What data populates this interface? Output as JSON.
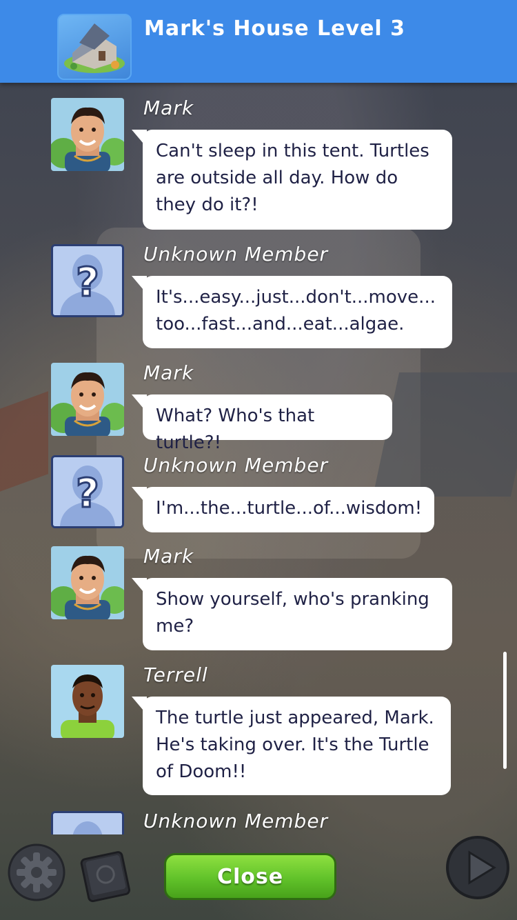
{
  "header": {
    "title": "Mark's House Level 3",
    "thumbnail_icon": "house-thumbnail-icon",
    "color": "#3d8ae8"
  },
  "messages": [
    {
      "sender": "Mark",
      "avatar": "mark",
      "text": "Can't sleep in this tent. Turtles are outside all day. How do they do it?!"
    },
    {
      "sender": "Unknown Member",
      "avatar": "unknown",
      "text": "It's...easy...just...don't...move... too...fast...and...eat...algae."
    },
    {
      "sender": "Mark",
      "avatar": "mark",
      "text": "What? Who's that turtle?!"
    },
    {
      "sender": "Unknown Member",
      "avatar": "unknown",
      "text": "I'm...the...turtle...of...wisdom!"
    },
    {
      "sender": "Mark",
      "avatar": "mark",
      "text": "Show yourself, who's pranking me?"
    },
    {
      "sender": "Terrell",
      "avatar": "terrell",
      "text": "The turtle just appeared, Mark. He's taking over. It's the Turtle of Doom!!"
    },
    {
      "sender": "Unknown Member",
      "avatar": "unknown",
      "text": ""
    }
  ],
  "footer": {
    "close_label": "Close",
    "close_color": "#61c22a",
    "settings_icon": "gear-icon",
    "book_icon": "book-icon",
    "play_icon": "play-icon"
  }
}
